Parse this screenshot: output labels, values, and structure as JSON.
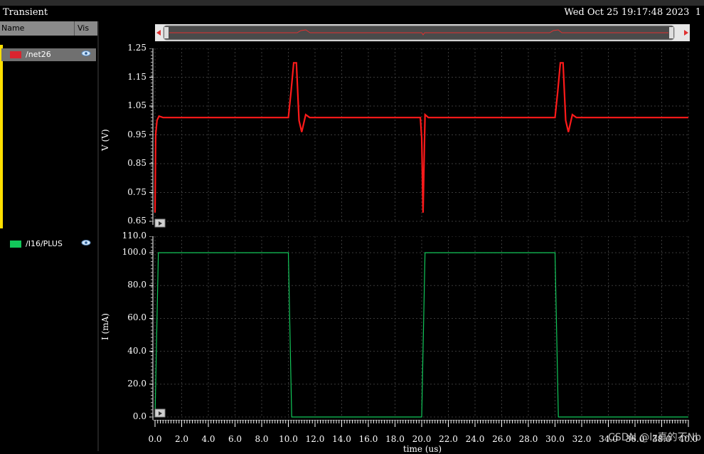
{
  "window": {
    "title": "Transient",
    "datetime": "Wed Oct 25 19:17:48 2023",
    "page": "1"
  },
  "panel": {
    "col_name": "Name",
    "col_vis": "Vis",
    "signals": [
      {
        "label": "/net26",
        "color": "#ff2a2a"
      },
      {
        "label": "/I16/PLUS",
        "color": "#12c85a"
      }
    ]
  },
  "chart_data": [
    {
      "type": "line",
      "ylabel": "V (V)",
      "ylim": [
        0.65,
        1.25
      ],
      "yticks": [
        "1.25",
        "1.15",
        "1.05",
        "0.95",
        "0.85",
        "0.75",
        "0.65"
      ],
      "series": [
        {
          "name": "/net26",
          "color": "#ff1a1a",
          "x": [
            0,
            0.05,
            0.15,
            0.3,
            0.6,
            10.0,
            10.2,
            10.4,
            10.6,
            10.8,
            11.0,
            11.3,
            11.6,
            19.9,
            20.0,
            20.1,
            20.25,
            20.5,
            30.0,
            30.2,
            30.4,
            30.6,
            30.8,
            31.0,
            31.3,
            31.6,
            40.0
          ],
          "y": [
            0.68,
            0.95,
            1.0,
            1.015,
            1.01,
            1.01,
            1.1,
            1.2,
            1.2,
            1.0,
            0.96,
            1.02,
            1.01,
            1.01,
            0.94,
            0.68,
            1.02,
            1.01,
            1.01,
            1.1,
            1.2,
            1.2,
            1.0,
            0.96,
            1.02,
            1.01,
            1.01
          ]
        }
      ]
    },
    {
      "type": "line",
      "ylabel": "I (mA)",
      "xlabel": "time (us)",
      "ylim": [
        0,
        110
      ],
      "yticks": [
        "110.0",
        "100.0",
        "80.0",
        "60.0",
        "40.0",
        "20.0",
        "0.0"
      ],
      "xlim": [
        0,
        40
      ],
      "xticks": [
        "0.0",
        "2.0",
        "4.0",
        "6.0",
        "8.0",
        "10.0",
        "12.0",
        "14.0",
        "16.0",
        "18.0",
        "20.0",
        "22.0",
        "24.0",
        "26.0",
        "28.0",
        "30.0",
        "32.0",
        "34.0",
        "36.0",
        "38.0",
        "40.0"
      ],
      "series": [
        {
          "name": "/I16/PLUS",
          "color": "#12c85a",
          "x": [
            0,
            0.25,
            10.0,
            10.25,
            20.0,
            20.25,
            30.0,
            30.25,
            40.0
          ],
          "y": [
            0,
            100,
            100,
            0,
            0,
            100,
            100,
            0,
            0
          ]
        }
      ]
    }
  ],
  "watermark": "CSDN @lz真的不Nb"
}
